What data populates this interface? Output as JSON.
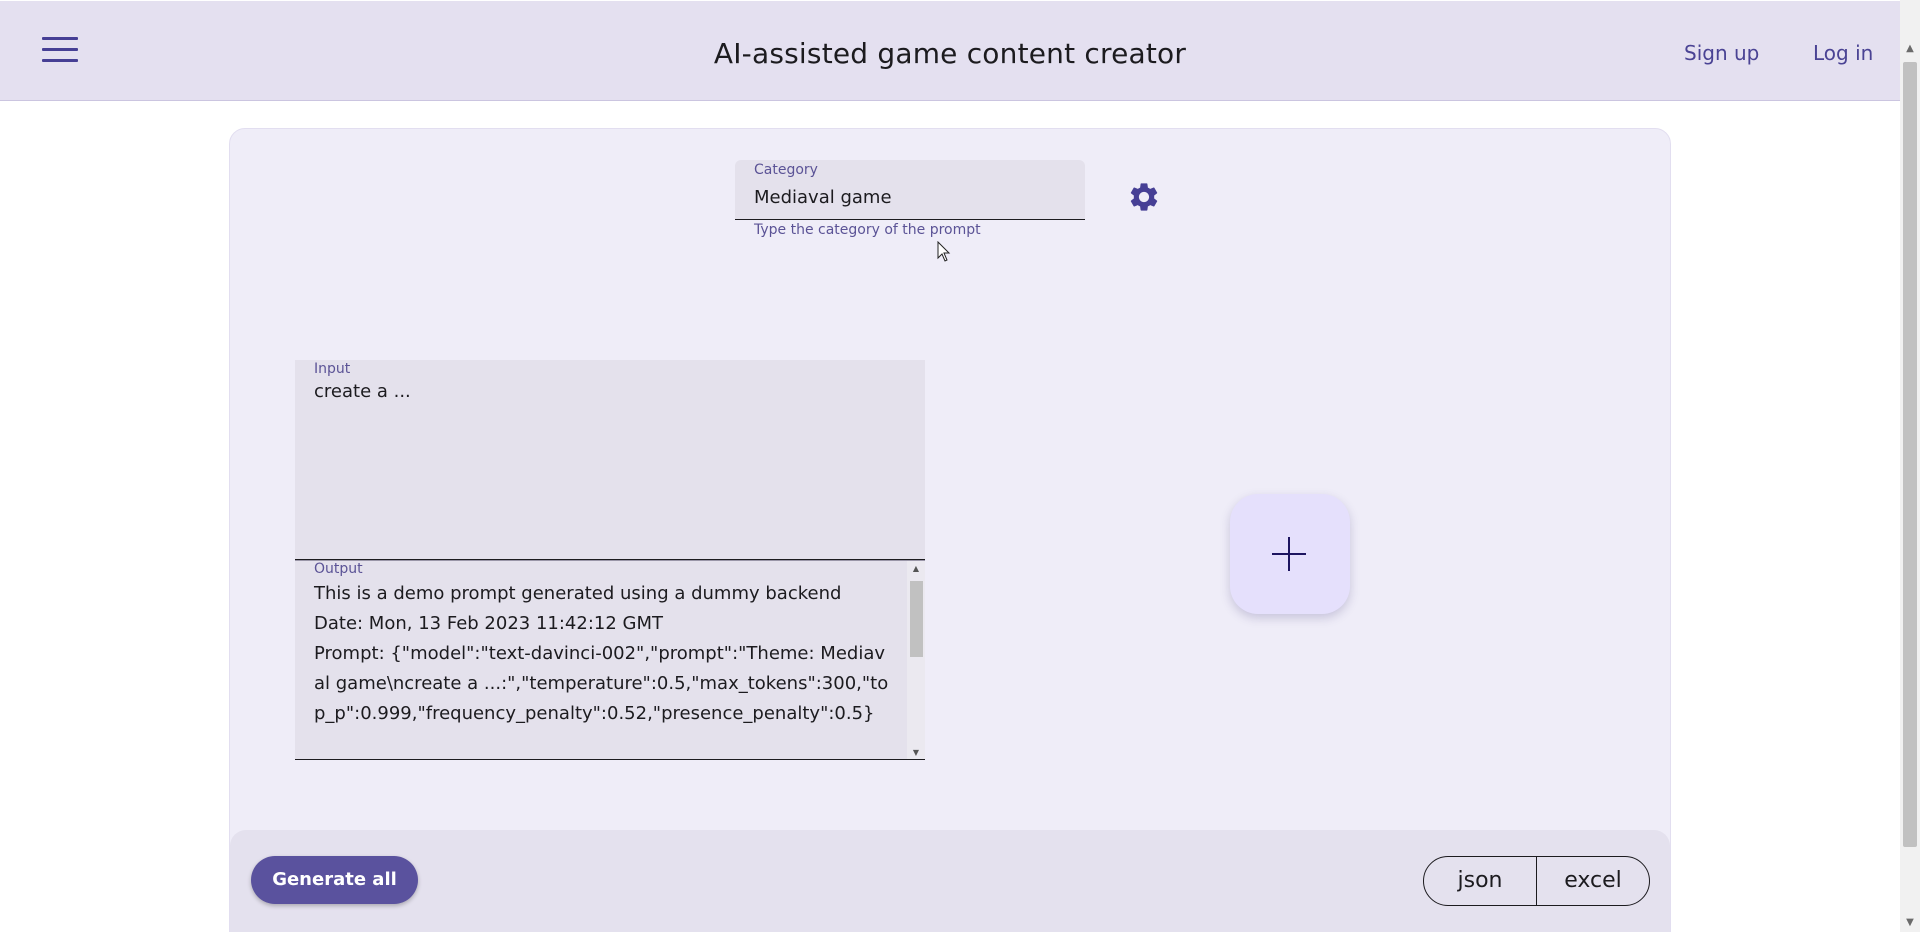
{
  "header": {
    "title": "AI-assisted game content creator",
    "signup_label": "Sign up",
    "login_label": "Log in"
  },
  "category": {
    "label": "Category",
    "value": "Mediaval game",
    "helper": "Type the category of the prompt"
  },
  "input": {
    "label": "Input",
    "value": "create a ..."
  },
  "output": {
    "label": "Output",
    "lines": [
      "This is a demo prompt generated using a dummy backend",
      "Date: Mon, 13 Feb 2023 11:42:12 GMT",
      "Prompt: {\"model\":\"text-davinci-002\",\"prompt\":\"Theme: Mediaval game\\ncreate a ...:\",\"temperature\":0.5,\"max_tokens\":300,\"top_p\":0.999,\"frequency_penalty\":0.52,\"presence_penalty\":0.5}"
    ]
  },
  "footer": {
    "generate_label": "Generate all",
    "json_label": "json",
    "excel_label": "excel"
  },
  "colors": {
    "primary": "#5a529e",
    "header_bg": "#e4e0f0",
    "card_bg": "#efedf8",
    "add_button_bg": "#e5e0fc"
  },
  "icons": {
    "menu": "hamburger-menu-icon",
    "settings": "gear-icon",
    "add": "plus-icon"
  }
}
